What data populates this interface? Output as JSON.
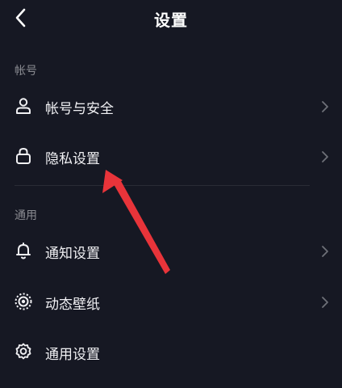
{
  "header": {
    "title": "设置",
    "back_icon": "chevron-left-icon"
  },
  "sections": [
    {
      "label": "帐号",
      "items": [
        {
          "label": "帐号与安全",
          "icon": "user-icon",
          "has_chevron": true
        },
        {
          "label": "隐私设置",
          "icon": "lock-icon",
          "has_chevron": true
        }
      ]
    },
    {
      "label": "通用",
      "items": [
        {
          "label": "通知设置",
          "icon": "bell-icon",
          "has_chevron": true
        },
        {
          "label": "动态壁纸",
          "icon": "live-wallpaper-icon",
          "has_chevron": true
        },
        {
          "label": "通用设置",
          "icon": "gear-icon",
          "has_chevron": false
        }
      ]
    }
  ],
  "annotation": {
    "type": "arrow",
    "color": "#e8343a",
    "points_to": "隐私设置"
  },
  "colors": {
    "background": "#161823",
    "text": "#f0f0f3",
    "muted": "#8a8b91"
  }
}
